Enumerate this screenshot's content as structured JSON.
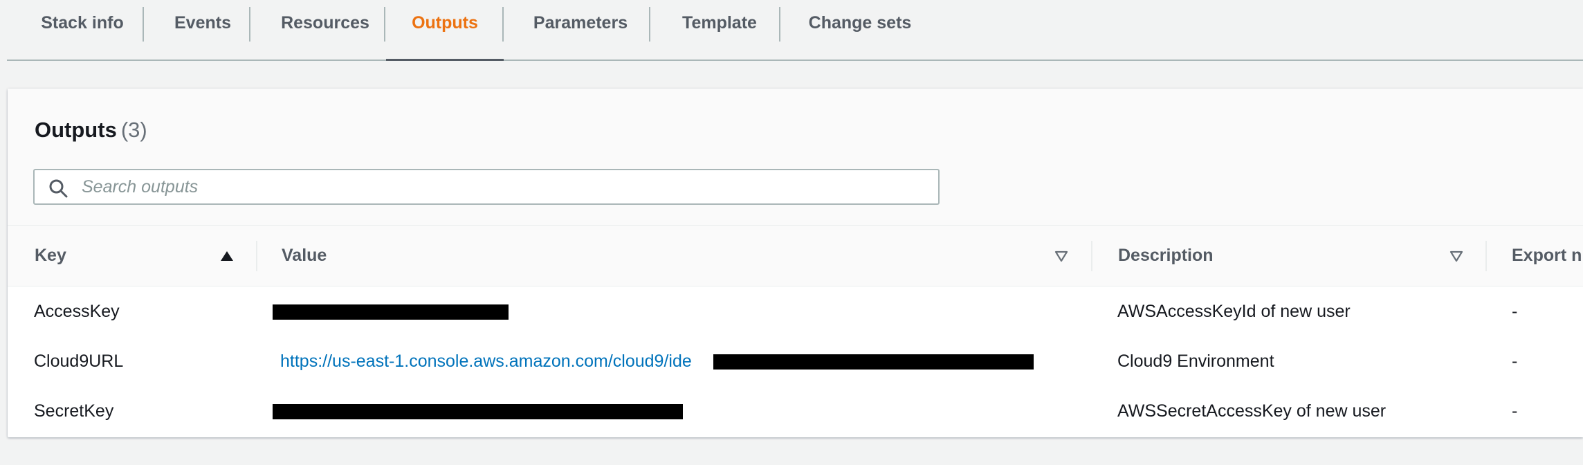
{
  "tabs": [
    {
      "label": "Stack info"
    },
    {
      "label": "Events"
    },
    {
      "label": "Resources"
    },
    {
      "label": "Outputs"
    },
    {
      "label": "Parameters"
    },
    {
      "label": "Template"
    },
    {
      "label": "Change sets"
    }
  ],
  "active_tab": "Outputs",
  "panel": {
    "title": "Outputs",
    "count": "(3)"
  },
  "search": {
    "placeholder": "Search outputs",
    "value": ""
  },
  "table": {
    "columns": [
      {
        "label": "Key",
        "sort": "ascending"
      },
      {
        "label": "Value",
        "sort": "none"
      },
      {
        "label": "Description",
        "sort": "none"
      },
      {
        "label": "Export n"
      }
    ],
    "rows": [
      {
        "key": "AccessKey",
        "value": "",
        "value_redacted": true,
        "description": "AWSAccessKeyId of new user",
        "export": "-"
      },
      {
        "key": "Cloud9URL",
        "value": "https://us-east-1.console.aws.amazon.com/cloud9/ide",
        "value_redacted": true,
        "description": "Cloud9 Environment",
        "export": "-"
      },
      {
        "key": "SecretKey",
        "value": "",
        "value_redacted": true,
        "description": "AWSSecretAccessKey of new user",
        "export": "-"
      }
    ]
  },
  "colors": {
    "active_tab": "#ec7211",
    "link": "#0073bb",
    "background": "#f2f3f3"
  }
}
